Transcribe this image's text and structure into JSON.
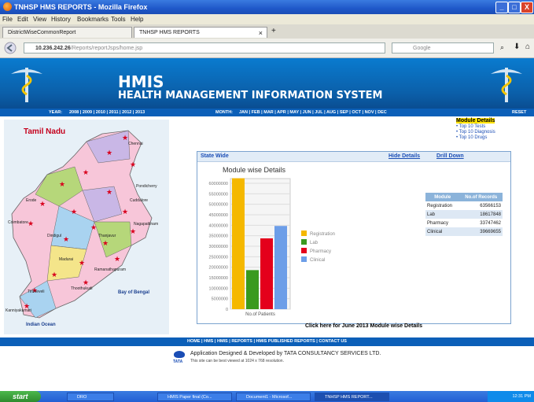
{
  "window": {
    "title": "TNHSP HMS REPORTS - Mozilla Firefox",
    "buttons": [
      "_",
      "□",
      "X"
    ]
  },
  "menu": [
    "File",
    "Edit",
    "View",
    "History",
    "Bookmarks",
    "Tools",
    "Help"
  ],
  "tabs": [
    {
      "label": "DistrictWiseCommonReport"
    },
    {
      "label": "TNHSP HMS REPORTS"
    }
  ],
  "tab_close": "×",
  "tab_new": "+",
  "nav": {
    "url_host": "10.236.242.26",
    "url_path": "/Reports/reportJsps/home.jsp",
    "search_placeholder": "Google"
  },
  "header": {
    "title": "HMIS",
    "subtitle": "HEALTH MANAGEMENT INFORMATION SYSTEM"
  },
  "yearbar": {
    "year_label": "YEAR:",
    "years": [
      "2008",
      "2009",
      "2010",
      "2011",
      "2012",
      "2013"
    ],
    "month_label": "MONTH:",
    "months": [
      "JAN",
      "FEB",
      "MAR",
      "APR",
      "MAY",
      "JUN",
      "JUL",
      "AUG",
      "SEP",
      "OCT",
      "NOV",
      "DEC"
    ],
    "reset": "RESET"
  },
  "side_links": {
    "selected": "Module Details",
    "items": [
      "Top 10 Tests",
      "Top 10 Diagnosis",
      "Top 10 Drugs"
    ]
  },
  "map": {
    "title": "Tamil Nadu",
    "labels": [
      "Chennai",
      "Bay of Bengal",
      "Indian Ocean",
      "Coimbatore",
      "Madurai",
      "Tiruneveli",
      "Kanniyakumari",
      "Pondicherry",
      "Cuddalore",
      "Nagapattinam",
      "Erode",
      "Thanjavur",
      "Ramanathapuram",
      "Thoothukudi",
      "Dindigul"
    ]
  },
  "panel": {
    "state": "State Wide",
    "hide": "Hide Details",
    "drill": "Drill Down"
  },
  "chart_data": {
    "type": "bar",
    "title": "Module wise Details",
    "xlabel": "No.of Patients",
    "ylabel": "",
    "ylim": [
      0,
      60000000
    ],
    "yticks": [
      "60000000",
      "55000000",
      "50000000",
      "45000000",
      "40000000",
      "35000000",
      "30000000",
      "25000000",
      "20000000",
      "15000000",
      "10000000",
      "5000000",
      "0"
    ],
    "series": [
      {
        "name": "Registration",
        "value": 63566153,
        "color": "#f5b800"
      },
      {
        "name": "Lab",
        "value": 18617848,
        "color": "#3a9a1e"
      },
      {
        "name": "Pharmacy",
        "value": 33747462,
        "color": "#e4001b"
      },
      {
        "name": "Clinical",
        "value": 39669655,
        "color": "#6d9ee8"
      }
    ],
    "legend": "right"
  },
  "table": {
    "headers": [
      "Module",
      "No.of Records"
    ],
    "rows": [
      [
        "Registration",
        "63566153"
      ],
      [
        "Lab",
        "18617848"
      ],
      [
        "Pharmacy",
        "33747462"
      ],
      [
        "Clinical",
        "39669655"
      ]
    ]
  },
  "clickhere": "Click here for June 2013 Module wise Details",
  "footer": {
    "links": [
      "HOME",
      "HMS",
      "HMIS",
      "REPORTS",
      "HMIS PUBLISHED REPORTS",
      "CONTACT US"
    ],
    "credit": "Application Designed & Developed by TATA CONSULTANCY SERVICES LTD.",
    "note": "This site can be best viewed at 1024 x 768 resolution.",
    "tata": "TATA"
  },
  "taskbar": {
    "start": "start",
    "items": [
      "DRO",
      "HMIS Paper final (Co...",
      "Document1 - Microsof...",
      "TNHSP HMS REPORT..."
    ],
    "clock": "12:31 PM"
  }
}
